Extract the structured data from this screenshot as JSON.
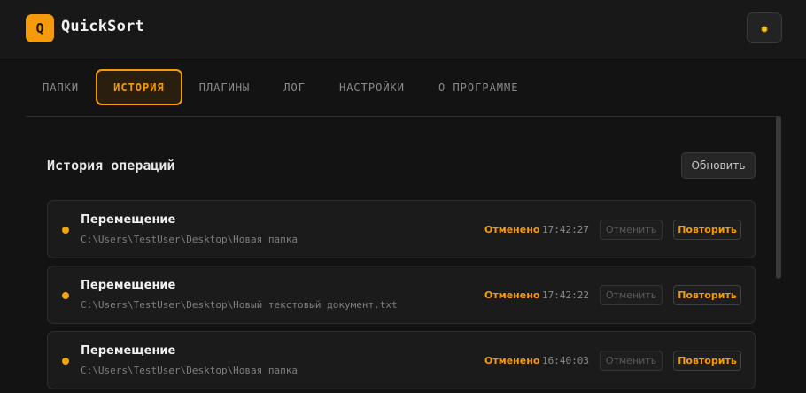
{
  "header": {
    "logo_letter": "Q",
    "app_title": "QuickSort",
    "theme_icon": "sun-icon",
    "theme_glyph": "✹"
  },
  "tabs": [
    {
      "label": "ПАПКИ",
      "active": false
    },
    {
      "label": "ИСТОРИЯ",
      "active": true
    },
    {
      "label": "ПЛАГИНЫ",
      "active": false
    },
    {
      "label": "ЛОГ",
      "active": false
    },
    {
      "label": "НАСТРОЙКИ",
      "active": false
    },
    {
      "label": "О ПРОГРАММЕ",
      "active": false
    }
  ],
  "history": {
    "title": "История операций",
    "refresh_label": "Обновить",
    "items": [
      {
        "type": "Перемещение",
        "path": "C:\\Users\\TestUser\\Desktop\\Новая папка",
        "status": "Отменено",
        "time": "17:42:27",
        "undo_label": "Отменить",
        "redo_label": "Повторить"
      },
      {
        "type": "Перемещение",
        "path": "C:\\Users\\TestUser\\Desktop\\Новый текстовый документ.txt",
        "status": "Отменено",
        "time": "17:42:22",
        "undo_label": "Отменить",
        "redo_label": "Повторить"
      },
      {
        "type": "Перемещение",
        "path": "C:\\Users\\TestUser\\Desktop\\Новая папка",
        "status": "Отменено",
        "time": "16:40:03",
        "undo_label": "Отменить",
        "redo_label": "Повторить"
      }
    ]
  },
  "colors": {
    "accent": "#f59b0b",
    "background": "#131313"
  }
}
